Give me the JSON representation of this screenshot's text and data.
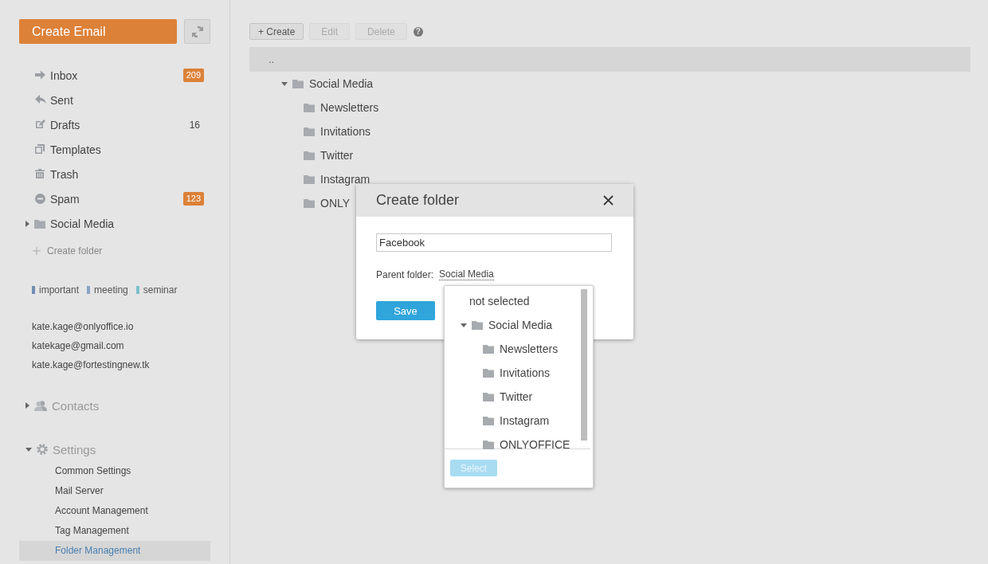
{
  "sidebar": {
    "create_button": "Create Email",
    "folders": [
      {
        "kind": "inbox",
        "label": "Inbox",
        "count": "209",
        "count_highlighted": true
      },
      {
        "kind": "sent",
        "label": "Sent"
      },
      {
        "kind": "drafts",
        "label": "Drafts",
        "count": "16",
        "count_highlighted": false
      },
      {
        "kind": "templates",
        "label": "Templates"
      },
      {
        "kind": "trash",
        "label": "Trash"
      },
      {
        "kind": "spam",
        "label": "Spam",
        "count": "123",
        "count_highlighted": true
      }
    ],
    "user_folders": [
      {
        "label": "Social Media",
        "expanded": false
      }
    ],
    "create_folder": "Create folder",
    "tags": [
      {
        "label": "important",
        "color": "#6f8fb3"
      },
      {
        "label": "meeting",
        "color": "#8aa2c4"
      },
      {
        "label": "seminar",
        "color": "#7cbfcc"
      }
    ],
    "accounts": [
      "kate.kage@onlyoffice.io",
      "katekage@gmail.com",
      "kate.kage@fortestingnew.tk"
    ],
    "contacts": {
      "label": "Contacts",
      "expanded": false
    },
    "settings": {
      "label": "Settings",
      "expanded": true,
      "items": [
        {
          "label": "Common Settings",
          "selected": false
        },
        {
          "label": "Mail Server",
          "selected": false
        },
        {
          "label": "Account Management",
          "selected": false
        },
        {
          "label": "Tag Management",
          "selected": false
        },
        {
          "label": "Folder Management",
          "selected": true
        }
      ]
    }
  },
  "toolbar": {
    "buttons": [
      {
        "label": "+ Create",
        "disabled": false
      },
      {
        "label": "Edit",
        "disabled": true
      },
      {
        "label": "Delete",
        "disabled": true
      }
    ],
    "help": "?"
  },
  "folder_tree": {
    "parent_row": "..",
    "folders": [
      {
        "label": "Social Media",
        "expanded": true,
        "children": [
          {
            "label": "Newsletters"
          },
          {
            "label": "Invitations"
          },
          {
            "label": "Twitter"
          },
          {
            "label": "Instagram"
          },
          {
            "label": "ONLY"
          }
        ]
      }
    ]
  },
  "dialog": {
    "title": "Create folder",
    "name_value": "Facebook",
    "parent_label": "Parent folder:",
    "parent_value": "Social Media",
    "save_button": "Save",
    "dropdown": {
      "items": [
        {
          "label": "not selected",
          "selected": false
        },
        {
          "label": "Social Media",
          "expanded": true,
          "selected": false,
          "children": [
            {
              "label": "Newsletters",
              "selected": false
            },
            {
              "label": "Invitations",
              "selected": false
            },
            {
              "label": "Twitter",
              "selected": false
            },
            {
              "label": "Instagram",
              "selected": false
            },
            {
              "label": "ONLYOFFICE",
              "selected": false
            }
          ]
        }
      ],
      "select_button": {
        "label": "Select",
        "disabled": true
      }
    }
  }
}
